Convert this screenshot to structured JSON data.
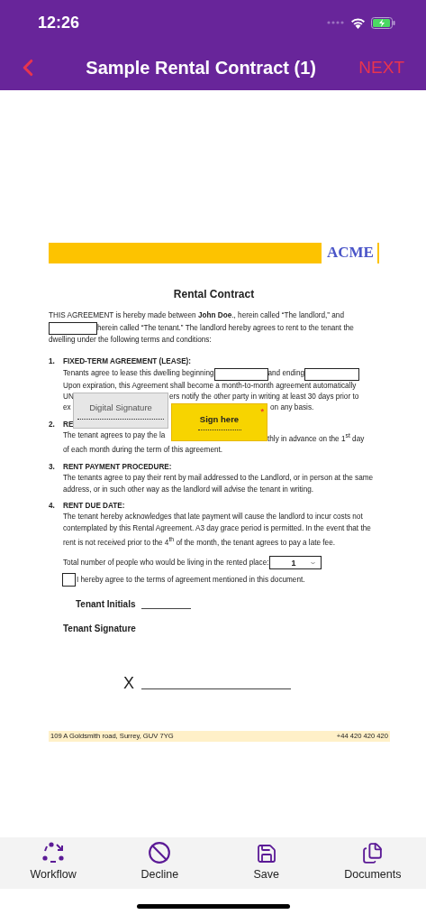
{
  "status_bar": {
    "time": "12:26"
  },
  "nav": {
    "title": "Sample Rental Contract (1)",
    "action": "NEXT"
  },
  "document": {
    "logo": "ACME",
    "title": "Rental Contract",
    "intro": {
      "line_1": "THIS AGREEMENT is hereby made between **John Doe**., herein called “The landlord,” and",
      "line_2": "herein called “The tenant.”  The landlord hereby agrees to rent to the tenant the",
      "line_3": "dwelling under the following terms and conditions:"
    },
    "clause_1": {
      "number": "1.",
      "heading": "FIXED-TERM AGREEMENT (LEASE):",
      "begin_text": "Tenants agree to lease this dwelling beginning",
      "end_text": "and ending",
      "line_3": "Upon expiration, this Agreement shall become a month-to-month agreement automatically",
      "line_4_left": "UN",
      "line_4_right": "ers notify the other party in writing at least 30 days prior to",
      "line_5_left": "ex",
      "line_5_right": "on any basis."
    },
    "clause_2": {
      "number": "2.",
      "heading": "RE",
      "line_1_left": "The tenant agrees to pay the la",
      "line_1_right": "thly in advance on the 1$^{st}$ day",
      "line_2": "of each month during the term of this agreement."
    },
    "clause_3": {
      "number": "3.",
      "heading": "RENT PAYMENT PROCEDURE:",
      "body": "The tenants agree to pay their rent by mail addressed to the Landlord, or in person at the same address, or in such other way as the landlord will advise the tenant in writing."
    },
    "clause_4": {
      "number": "4.",
      "heading": "RENT DUE DATE:",
      "body": "The tenant hereby acknowledges that late payment will cause the landlord to incur costs not contemplated by this Rental Agreement.  A3 day grace period is permitted.  In the event that the rent is not received prior to the 4$^{th}$ of the month, the tenant agrees to pay a late fee."
    },
    "occupants": {
      "label": "Total number of people who would be living in the rented place:",
      "value": "1"
    },
    "agree": {
      "label": "I hereby agree to the terms of agreement mentioned in this document.",
      "checked": false
    },
    "initials_label": "Tenant Initials",
    "signature_label": "Tenant Signature",
    "sign_mark": "X",
    "footer": {
      "address": "109 A Goldsmith road, Surrey, GUV 7YG",
      "phone": "+44 420 420 420"
    }
  },
  "overlays": {
    "digital_signature": "Digital Signature",
    "sign_here": {
      "label": "Sign here",
      "required": true,
      "required_mark": "*"
    }
  },
  "toolbar": [
    {
      "label": "Workflow",
      "kind": "workflow"
    },
    {
      "label": "Decline",
      "kind": "decline"
    },
    {
      "label": "Save",
      "kind": "save"
    },
    {
      "label": "Documents",
      "kind": "documents"
    }
  ]
}
